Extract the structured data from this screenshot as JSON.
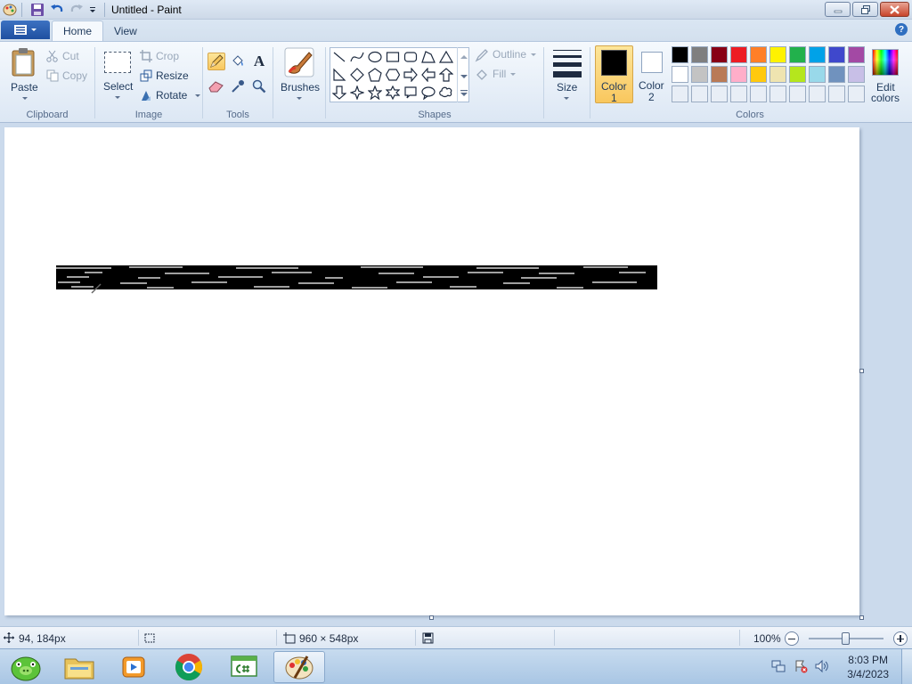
{
  "window": {
    "title": "Untitled - Paint"
  },
  "tabs": [
    {
      "label": "Home",
      "active": true
    },
    {
      "label": "View",
      "active": false
    }
  ],
  "help_label": "?",
  "ribbon": {
    "clipboard": {
      "label": "Clipboard",
      "paste": "Paste",
      "cut": "Cut",
      "copy": "Copy"
    },
    "image": {
      "label": "Image",
      "select": "Select",
      "crop": "Crop",
      "resize": "Resize",
      "rotate": "Rotate"
    },
    "tools": {
      "label": "Tools",
      "items": [
        "pencil",
        "fill",
        "text",
        "eraser",
        "color-picker",
        "magnifier"
      ],
      "selected": "pencil",
      "text_glyph": "A"
    },
    "brushes": {
      "label": "Brushes"
    },
    "shapes": {
      "label": "Shapes",
      "outline": "Outline",
      "fill": "Fill",
      "items": [
        "line",
        "curve",
        "oval",
        "rectangle",
        "rounded-rectangle",
        "polygon",
        "triangle",
        "right-triangle",
        "diamond",
        "pentagon",
        "hexagon",
        "right-arrow",
        "left-arrow",
        "up-arrow",
        "down-arrow",
        "four-point-star",
        "five-point-star",
        "six-point-star",
        "rounded-callout",
        "oval-callout",
        "cloud-callout"
      ]
    },
    "size": {
      "label": "Size"
    },
    "colors": {
      "label": "Colors",
      "color1": {
        "label1": "Color",
        "label2": "1",
        "value": "#000000"
      },
      "color2": {
        "label1": "Color",
        "label2": "2",
        "value": "#ffffff"
      },
      "edit": {
        "label1": "Edit",
        "label2": "colors"
      },
      "palette_row1": [
        "#000000",
        "#7f7f7f",
        "#880015",
        "#ed1c24",
        "#ff7f27",
        "#fff200",
        "#22b14c",
        "#00a2e8",
        "#3f48cc",
        "#a349a4"
      ],
      "palette_row2": [
        "#ffffff",
        "#c3c3c3",
        "#b97a57",
        "#ffaec9",
        "#ffc90e",
        "#efe4b0",
        "#b5e61d",
        "#99d9ea",
        "#7092be",
        "#c8bfe7"
      ],
      "palette_row3": [
        "#e8eef6",
        "#e8eef6",
        "#e8eef6",
        "#e8eef6",
        "#e8eef6",
        "#e8eef6",
        "#e8eef6",
        "#e8eef6",
        "#e8eef6",
        "#e8eef6"
      ]
    }
  },
  "status": {
    "cursor_pos": "94, 184px",
    "canvas_size": "960 × 548px",
    "zoom": "100%",
    "zoom_level": 0.5
  },
  "taskbar": {
    "apps": [
      "angry-birds-icon",
      "file-explorer-icon",
      "media-player-icon",
      "chrome-icon",
      "csharp-editor-icon",
      "paint-icon"
    ],
    "time": "8:03 PM",
    "date": "3/4/2023"
  }
}
